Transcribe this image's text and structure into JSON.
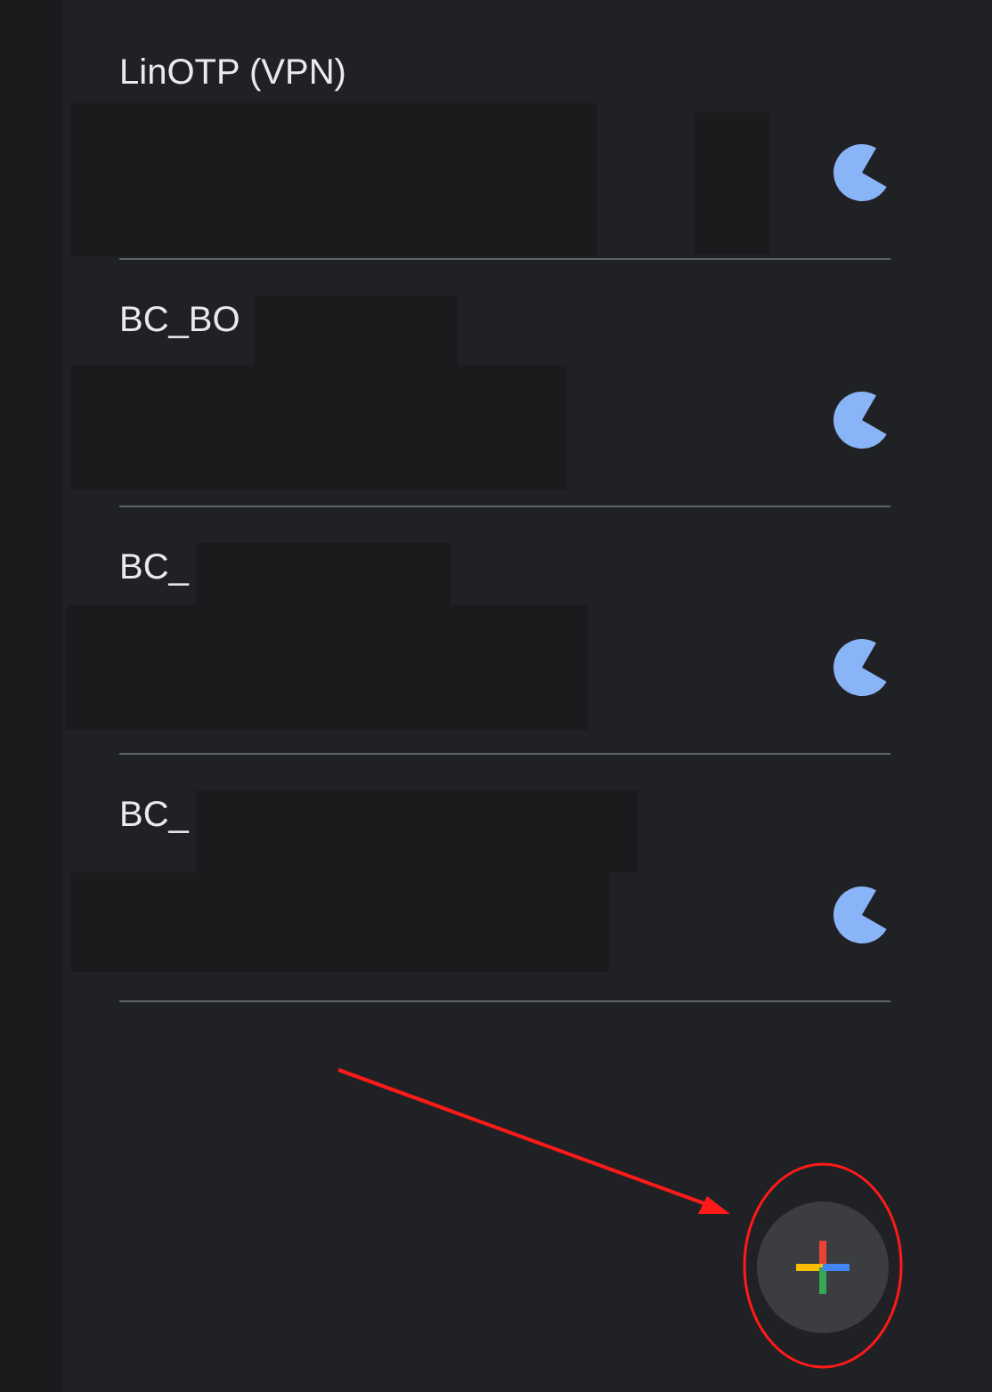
{
  "accounts": [
    {
      "name": "LinOTP (VPN)"
    },
    {
      "name": "BC_BO"
    },
    {
      "name": "BC_"
    },
    {
      "name": "BC_"
    }
  ]
}
